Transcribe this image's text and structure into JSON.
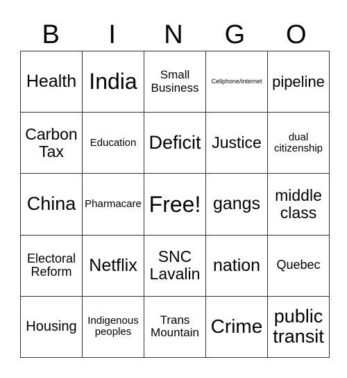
{
  "header": [
    "B",
    "I",
    "N",
    "G",
    "O"
  ],
  "rows": [
    [
      "Health",
      "India",
      "Small Business",
      "Cellphone/internet",
      "pipeline"
    ],
    [
      "Carbon Tax",
      "Education",
      "Deficit",
      "Justice",
      "dual citizenship"
    ],
    [
      "China",
      "Pharmacare",
      "Free!",
      "gangs",
      "middle class"
    ],
    [
      "Electoral Reform",
      "Netflix",
      "SNC Lavalin",
      "nation",
      "Quebec"
    ],
    [
      "Housing",
      "Indigenous peoples",
      "Trans Mountain",
      "Crime",
      "public transit"
    ]
  ]
}
